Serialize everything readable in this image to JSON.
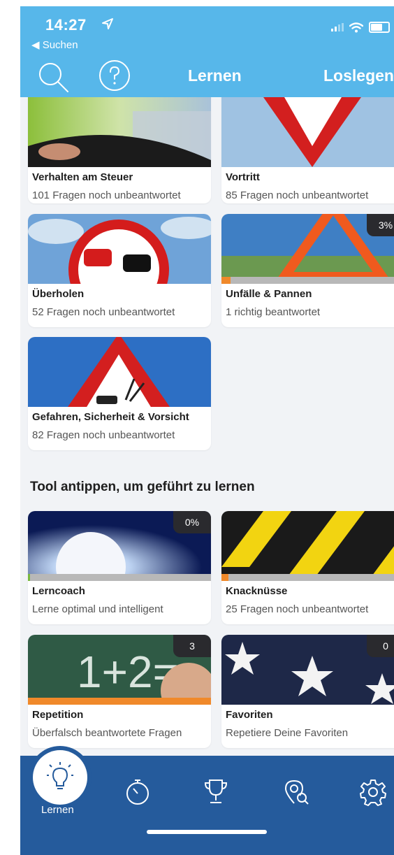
{
  "status_bar": {
    "time": "14:27",
    "back_label": "◀ Suchen"
  },
  "header": {
    "title": "Lernen",
    "right_action": "Loslegen"
  },
  "categories": [
    {
      "title": "Verhalten am Steuer",
      "subtitle": "101 Fragen noch unbeantwortet"
    },
    {
      "title": "Vortritt",
      "subtitle": "85 Fragen noch unbeantwortet"
    },
    {
      "title": "Überholen",
      "subtitle": "52 Fragen noch unbeantwortet"
    },
    {
      "title": "Unfälle & Pannen",
      "subtitle": "1 richtig beantwortet",
      "badge": "3%",
      "progress": 0.05
    },
    {
      "title": "Gefahren, Sicherheit & Vorsicht",
      "subtitle": "82 Fragen noch unbeantwortet"
    }
  ],
  "tools_section": {
    "title": "Tool antippen, um geführt zu lernen"
  },
  "tools": [
    {
      "title": "Lerncoach",
      "subtitle": "Lerne optimal und intelligent",
      "badge": "0%",
      "progress": 0.01
    },
    {
      "title": "Knacknüsse",
      "subtitle": "25 Fragen noch unbeantwortet",
      "progress": 0.04
    },
    {
      "title": "Repetition",
      "subtitle": "Überfalsch beantwortete Fragen",
      "badge": "3",
      "progress": 1.0
    },
    {
      "title": "Favoriten",
      "subtitle": "Repetiere Deine Favoriten",
      "badge": "0"
    }
  ],
  "tabbar": {
    "active_label": "Lernen",
    "icons": [
      "lightbulb-icon",
      "stopwatch-icon",
      "trophy-icon",
      "location-search-icon",
      "gear-icon"
    ]
  },
  "colors": {
    "header": "#57b7ea",
    "tabbar": "#255b9c",
    "progress": "#f0892a"
  }
}
